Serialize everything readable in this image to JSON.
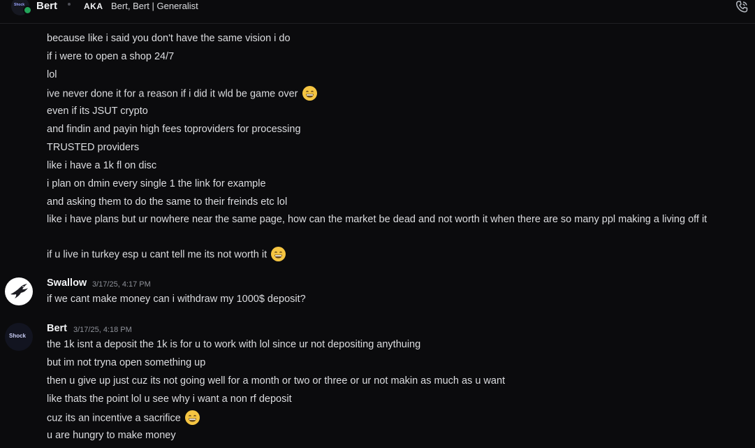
{
  "header": {
    "name": "Bert",
    "aka_label": "AKA",
    "aka_names": "Bert, Bert | Generalist",
    "avatar_text": "Shock"
  },
  "messages_top": [
    "because like i said you don't have the same vision i do",
    "if i were to open a shop 24/7",
    "lol",
    "ive never done it for a reason if i did it wld be game over",
    "even if its JSUT crypto",
    "and findin and payin high fees toproviders for processing",
    "TRUSTED providers",
    "like i have a 1k fl on disc",
    "i plan on dmin every single 1 the link for example",
    "and asking them to do the same to their freinds etc lol",
    "like i have plans but ur nowhere near the same page, how can the market be dead and not worth it when there are so many ppl making a living off it",
    "if u live in turkey esp u cant tell me its not worth it"
  ],
  "swallow": {
    "author": "Swallow",
    "timestamp": "3/17/25, 4:17 PM",
    "text": "if we cant make money can i withdraw my 1000$ deposit?"
  },
  "bert": {
    "author": "Bert",
    "timestamp": "3/17/25, 4:18 PM",
    "avatar_text": "Shock",
    "lines": [
      "the 1k isnt a deposit the 1k is for u to work with lol since ur not depositing anythuing",
      "but im not tryna open something up",
      "then u give up just cuz its not going well for a month or two or three or ur not makin as much as u want",
      "like thats the point lol u see why i want a non rf deposit",
      "cuz its an incentive a sacrifice",
      "u are hungry to make money"
    ]
  }
}
